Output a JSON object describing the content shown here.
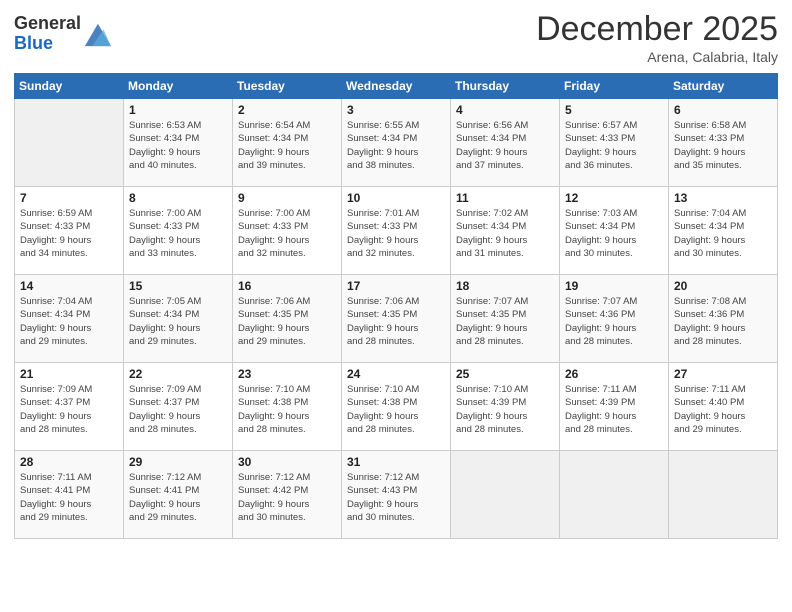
{
  "logo": {
    "general": "General",
    "blue": "Blue"
  },
  "title": "December 2025",
  "location": "Arena, Calabria, Italy",
  "days": [
    "Sunday",
    "Monday",
    "Tuesday",
    "Wednesday",
    "Thursday",
    "Friday",
    "Saturday"
  ],
  "weeks": [
    [
      {
        "day": "",
        "content": ""
      },
      {
        "day": "1",
        "content": "Sunrise: 6:53 AM\nSunset: 4:34 PM\nDaylight: 9 hours\nand 40 minutes."
      },
      {
        "day": "2",
        "content": "Sunrise: 6:54 AM\nSunset: 4:34 PM\nDaylight: 9 hours\nand 39 minutes."
      },
      {
        "day": "3",
        "content": "Sunrise: 6:55 AM\nSunset: 4:34 PM\nDaylight: 9 hours\nand 38 minutes."
      },
      {
        "day": "4",
        "content": "Sunrise: 6:56 AM\nSunset: 4:34 PM\nDaylight: 9 hours\nand 37 minutes."
      },
      {
        "day": "5",
        "content": "Sunrise: 6:57 AM\nSunset: 4:33 PM\nDaylight: 9 hours\nand 36 minutes."
      },
      {
        "day": "6",
        "content": "Sunrise: 6:58 AM\nSunset: 4:33 PM\nDaylight: 9 hours\nand 35 minutes."
      }
    ],
    [
      {
        "day": "7",
        "content": "Sunrise: 6:59 AM\nSunset: 4:33 PM\nDaylight: 9 hours\nand 34 minutes."
      },
      {
        "day": "8",
        "content": "Sunrise: 7:00 AM\nSunset: 4:33 PM\nDaylight: 9 hours\nand 33 minutes."
      },
      {
        "day": "9",
        "content": "Sunrise: 7:00 AM\nSunset: 4:33 PM\nDaylight: 9 hours\nand 32 minutes."
      },
      {
        "day": "10",
        "content": "Sunrise: 7:01 AM\nSunset: 4:33 PM\nDaylight: 9 hours\nand 32 minutes."
      },
      {
        "day": "11",
        "content": "Sunrise: 7:02 AM\nSunset: 4:34 PM\nDaylight: 9 hours\nand 31 minutes."
      },
      {
        "day": "12",
        "content": "Sunrise: 7:03 AM\nSunset: 4:34 PM\nDaylight: 9 hours\nand 30 minutes."
      },
      {
        "day": "13",
        "content": "Sunrise: 7:04 AM\nSunset: 4:34 PM\nDaylight: 9 hours\nand 30 minutes."
      }
    ],
    [
      {
        "day": "14",
        "content": "Sunrise: 7:04 AM\nSunset: 4:34 PM\nDaylight: 9 hours\nand 29 minutes."
      },
      {
        "day": "15",
        "content": "Sunrise: 7:05 AM\nSunset: 4:34 PM\nDaylight: 9 hours\nand 29 minutes."
      },
      {
        "day": "16",
        "content": "Sunrise: 7:06 AM\nSunset: 4:35 PM\nDaylight: 9 hours\nand 29 minutes."
      },
      {
        "day": "17",
        "content": "Sunrise: 7:06 AM\nSunset: 4:35 PM\nDaylight: 9 hours\nand 28 minutes."
      },
      {
        "day": "18",
        "content": "Sunrise: 7:07 AM\nSunset: 4:35 PM\nDaylight: 9 hours\nand 28 minutes."
      },
      {
        "day": "19",
        "content": "Sunrise: 7:07 AM\nSunset: 4:36 PM\nDaylight: 9 hours\nand 28 minutes."
      },
      {
        "day": "20",
        "content": "Sunrise: 7:08 AM\nSunset: 4:36 PM\nDaylight: 9 hours\nand 28 minutes."
      }
    ],
    [
      {
        "day": "21",
        "content": "Sunrise: 7:09 AM\nSunset: 4:37 PM\nDaylight: 9 hours\nand 28 minutes."
      },
      {
        "day": "22",
        "content": "Sunrise: 7:09 AM\nSunset: 4:37 PM\nDaylight: 9 hours\nand 28 minutes."
      },
      {
        "day": "23",
        "content": "Sunrise: 7:10 AM\nSunset: 4:38 PM\nDaylight: 9 hours\nand 28 minutes."
      },
      {
        "day": "24",
        "content": "Sunrise: 7:10 AM\nSunset: 4:38 PM\nDaylight: 9 hours\nand 28 minutes."
      },
      {
        "day": "25",
        "content": "Sunrise: 7:10 AM\nSunset: 4:39 PM\nDaylight: 9 hours\nand 28 minutes."
      },
      {
        "day": "26",
        "content": "Sunrise: 7:11 AM\nSunset: 4:39 PM\nDaylight: 9 hours\nand 28 minutes."
      },
      {
        "day": "27",
        "content": "Sunrise: 7:11 AM\nSunset: 4:40 PM\nDaylight: 9 hours\nand 29 minutes."
      }
    ],
    [
      {
        "day": "28",
        "content": "Sunrise: 7:11 AM\nSunset: 4:41 PM\nDaylight: 9 hours\nand 29 minutes."
      },
      {
        "day": "29",
        "content": "Sunrise: 7:12 AM\nSunset: 4:41 PM\nDaylight: 9 hours\nand 29 minutes."
      },
      {
        "day": "30",
        "content": "Sunrise: 7:12 AM\nSunset: 4:42 PM\nDaylight: 9 hours\nand 30 minutes."
      },
      {
        "day": "31",
        "content": "Sunrise: 7:12 AM\nSunset: 4:43 PM\nDaylight: 9 hours\nand 30 minutes."
      },
      {
        "day": "",
        "content": ""
      },
      {
        "day": "",
        "content": ""
      },
      {
        "day": "",
        "content": ""
      }
    ]
  ]
}
